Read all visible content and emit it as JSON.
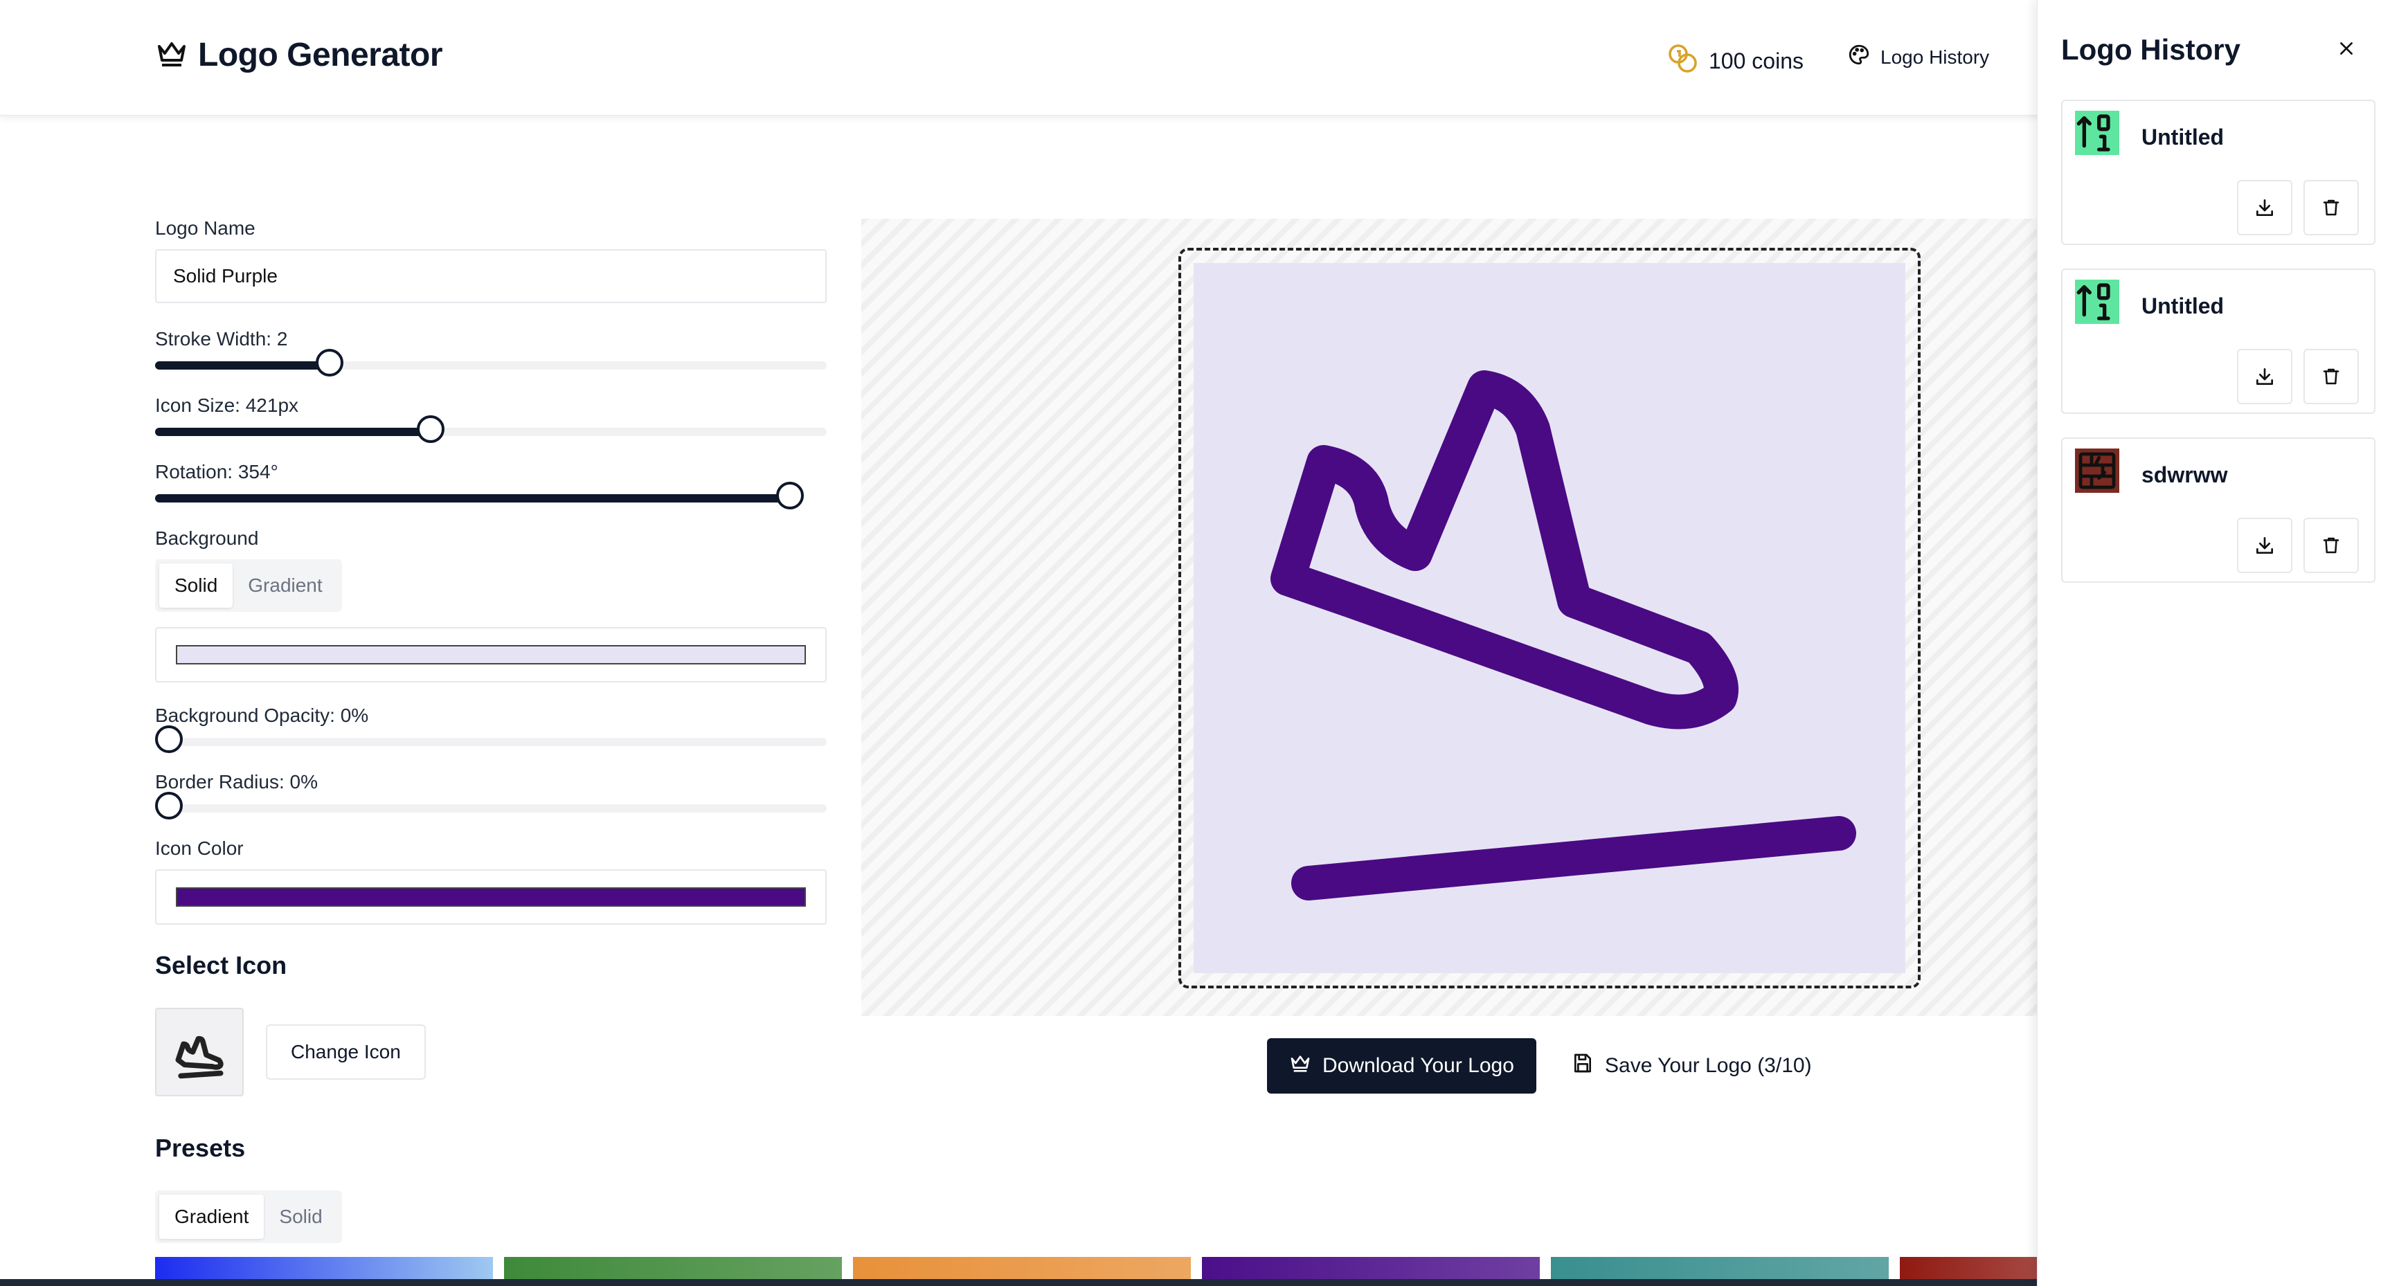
{
  "header": {
    "app_title": "Logo Generator",
    "coins_label": "100 coins",
    "history_button_label": "Logo History"
  },
  "form": {
    "logo_name_label": "Logo Name",
    "logo_name_value": "Solid Purple",
    "stroke_width": {
      "label": "Stroke Width: 2",
      "fraction": 0.26
    },
    "icon_size": {
      "label": "Icon Size: 421px",
      "fraction": 0.41
    },
    "rotation": {
      "label": "Rotation: 354°",
      "fraction": 0.98
    },
    "background_label": "Background",
    "background_tabs": [
      "Solid",
      "Gradient"
    ],
    "background_active_tab": "Solid",
    "background_color": "#e6e4f4",
    "background_opacity": {
      "label": "Background Opacity: 0%",
      "fraction": 0.0
    },
    "border_radius": {
      "label": "Border Radius: 0%",
      "fraction": 0.0
    },
    "icon_color_label": "Icon Color",
    "icon_color": "#4a0a84",
    "select_icon_heading": "Select Icon",
    "selected_icon": "sneaker-icon",
    "change_icon_button": "Change Icon",
    "presets_heading": "Presets",
    "preset_tabs": [
      "Gradient",
      "Solid"
    ],
    "preset_active_tab": "Gradient",
    "preset_colors": [
      "#1d2cf0",
      "#3f8a3a",
      "#e8913a",
      "#4b0f8a",
      "#3a8f8f",
      "#8f1a12"
    ]
  },
  "preview": {
    "icon": "sneaker-icon",
    "icon_color": "#4a0a84",
    "background_color": "#e6e4f4"
  },
  "actions": {
    "download_label": "Download Your Logo",
    "save_label": "Save Your Logo (3/10)"
  },
  "history": {
    "title": "Logo History",
    "items": [
      {
        "name": "Untitled",
        "thumb": "sort-number-icon",
        "thumb_bg": "#5ee6a0"
      },
      {
        "name": "Untitled",
        "thumb": "sort-number-icon",
        "thumb_bg": "#5ee6a0"
      },
      {
        "name": "sdwrww",
        "thumb": "brick-wall-icon",
        "thumb_bg": "#7a2a22"
      }
    ]
  }
}
